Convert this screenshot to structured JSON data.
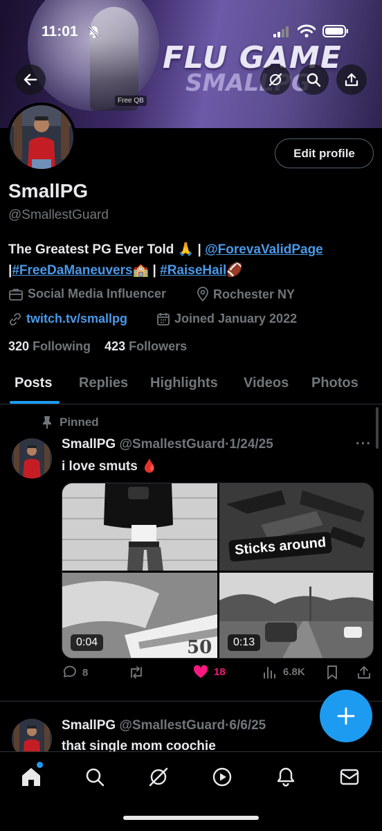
{
  "status_bar": {
    "time": "11:01"
  },
  "banner": {
    "title": "FLU GAME",
    "subtitle": "SMALLPG",
    "tag": "Free QB"
  },
  "header_buttons": [
    "back-icon",
    "grok-icon",
    "search-icon",
    "share-icon"
  ],
  "profile": {
    "display_name": "SmallPG",
    "handle": "@SmallestGuard",
    "edit_button": "Edit profile",
    "bio": {
      "text_start": "The Greatest PG Ever Told 🙏 | ",
      "mention": "@ForevaValidPage",
      "sep1": "|",
      "hashtag1": "#FreeDaManeuvers",
      "emoji1": "🏫",
      "sep2": " | ",
      "hashtag2": "#RaiseHail",
      "emoji2": "🏈"
    },
    "category": "Social Media Influencer",
    "location": "Rochester NY",
    "website": "twitch.tv/smallpg",
    "joined": "Joined January 2022",
    "following_count": "320",
    "following_label": "Following",
    "followers_count": "423",
    "followers_label": "Followers"
  },
  "tabs": [
    {
      "label": "Posts",
      "active": true
    },
    {
      "label": "Replies"
    },
    {
      "label": "Highlights"
    },
    {
      "label": "Videos"
    },
    {
      "label": "Photos"
    }
  ],
  "pinned_label": "Pinned",
  "posts": [
    {
      "name": "SmallPG",
      "handle": "@SmallestGuard",
      "date": "1/24/25",
      "text": "i love smuts 🩸",
      "media": {
        "sticker": "Sticks around",
        "video_durations": [
          "0:04",
          "0:13"
        ]
      },
      "replies": "8",
      "reposts": "",
      "likes": "18",
      "views": "6.8K"
    },
    {
      "name": "SmallPG",
      "handle": "@SmallestGuard",
      "date": "6/6/25",
      "text": "that single mom coochie"
    }
  ],
  "dot_separator": "·",
  "more_menu": "···",
  "bottom_nav": [
    "home-icon",
    "search-icon",
    "grok-icon",
    "play-icon",
    "bell-icon",
    "mail-icon"
  ],
  "colors": {
    "accent": "#1d9bf0",
    "like": "#f91880",
    "muted": "#71767b",
    "link": "#4a99e9",
    "background": "#000000"
  }
}
